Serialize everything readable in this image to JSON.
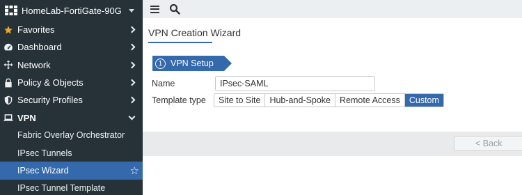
{
  "sidebar": {
    "device_name": "HomeLab-FortiGate-90G",
    "items": [
      {
        "label": "Favorites",
        "icon": "star-icon"
      },
      {
        "label": "Dashboard",
        "icon": "dashboard-icon"
      },
      {
        "label": "Network",
        "icon": "network-icon"
      },
      {
        "label": "Policy & Objects",
        "icon": "lock-icon"
      },
      {
        "label": "Security Profiles",
        "icon": "shield-icon"
      },
      {
        "label": "VPN",
        "icon": "laptop-icon"
      }
    ],
    "vpn_subitems": [
      {
        "label": "Fabric Overlay Orchestrator"
      },
      {
        "label": "IPsec Tunnels"
      },
      {
        "label": "IPsec Wizard"
      },
      {
        "label": "IPsec Tunnel Template"
      }
    ]
  },
  "page": {
    "title": "VPN Creation Wizard",
    "step_number": "1",
    "step_label": "VPN Setup",
    "name_label": "Name",
    "name_value": "IPsec-SAML",
    "template_label": "Template type",
    "template_options": [
      "Site to Site",
      "Hub-and-Spoke",
      "Remote Access",
      "Custom"
    ],
    "template_selected": "Custom",
    "back_label": "< Back"
  },
  "colors": {
    "sidebar_bg": "#263238",
    "accent": "#3469ab",
    "favorite_star": "#f5a623"
  }
}
